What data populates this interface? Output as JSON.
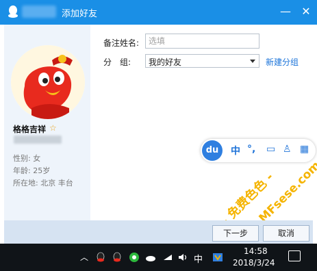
{
  "window": {
    "title": "添加好友",
    "close_symbol": "✕",
    "minimize_symbol": "—"
  },
  "profile": {
    "nickname": "格格吉祥",
    "star_icon": "star-icon",
    "gender": "性别: 女",
    "age": "年龄: 25岁",
    "location": "所在地: 北京  丰台"
  },
  "form": {
    "remark_label": "备注姓名:",
    "remark_placeholder": "选填",
    "remark_value": "",
    "group_label": "分　组:",
    "group_selected": "我的好友",
    "new_group_link": "新建分组"
  },
  "ime_toolbar": {
    "logo": "du",
    "items": [
      "中",
      "°,",
      "▭",
      "♙",
      "▦"
    ]
  },
  "watermark": {
    "text_line1": "- 免费色色 -",
    "text_line2": "www.MFsese.com",
    "color": "#f5b400"
  },
  "buttons": {
    "next": "下一步",
    "cancel": "取消"
  },
  "taskbar": {
    "input_lang": "中",
    "time": "14:58",
    "date": "2018/3/24",
    "tray_icons": [
      "chevron-up-icon",
      "qq-icon",
      "qq-icon",
      "wechat-icon",
      "onedrive-icon",
      "wifi-icon",
      "volume-icon",
      "ime-icon"
    ]
  },
  "colors": {
    "titlebar": "#1a8fe6",
    "link": "#1a73d9",
    "left_pane": "#eef4fb",
    "bottom_bar": "#d6e3f2",
    "taskbar": "#101418"
  }
}
